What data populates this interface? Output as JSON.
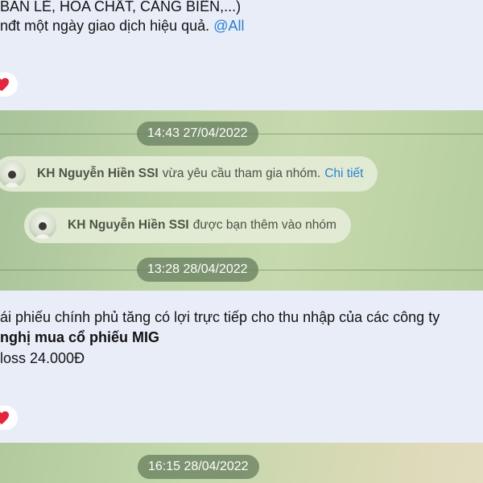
{
  "messages": {
    "top": {
      "line1": "BÁN LẺ, HÓA CHẤT, CẢNG BIỂN,...)",
      "line2": "nđt một ngày giao dịch hiệu quả.",
      "mention": "@All"
    },
    "middle": {
      "line1": "ái phiếu chính phủ tăng có lợi trực tiếp cho thu nhập của các công ty",
      "line2": "nghị mua cổ phiếu MIG",
      "line3": "loss 24.000Đ"
    }
  },
  "reactions": {
    "icon": "heart-icon",
    "color": "#e3263b"
  },
  "date_dividers": [
    "14:43 27/04/2022",
    "13:28 28/04/2022",
    "16:15 28/04/2022"
  ],
  "service_messages": [
    {
      "name": "KH Nguyễn Hiền SSI",
      "text": "vừa yêu cầu tham gia nhóm.",
      "link": "Chi tiết"
    },
    {
      "name": "KH Nguyễn Hiền SSI",
      "text": "được bạn thêm vào nhóm"
    }
  ],
  "colors": {
    "link": "#2a83d4",
    "wallpaper": "#bed3a8",
    "date_pill": "#69805f"
  }
}
